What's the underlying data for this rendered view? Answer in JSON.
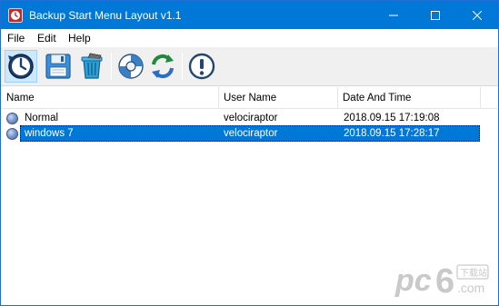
{
  "window": {
    "title": "Backup Start Menu Layout v1.1",
    "titlebar_color": "#0078d7"
  },
  "menubar": {
    "items": [
      {
        "label": "File"
      },
      {
        "label": "Edit"
      },
      {
        "label": "Help"
      }
    ]
  },
  "toolbar": {
    "buttons": [
      {
        "icon": "backup-clock-icon",
        "selected": true
      },
      {
        "icon": "save-floppy-icon"
      },
      {
        "icon": "recycle-bin-icon"
      },
      {
        "icon": "lifebuoy-icon"
      },
      {
        "icon": "refresh-icon"
      },
      {
        "icon": "exclamation-icon"
      }
    ]
  },
  "listview": {
    "columns": [
      "Name",
      "User Name",
      "Date And Time"
    ],
    "rows": [
      {
        "name": "Normal",
        "user": "velociraptor",
        "datetime": "2018.09.15 17:19:08",
        "selected": false
      },
      {
        "name": "windows 7",
        "user": "velociraptor",
        "datetime": "2018.09.15 17:28:17",
        "selected": true
      }
    ],
    "selection_color": "#0078d7"
  },
  "watermark": {
    "brand": "pc6",
    "tag": "下载站",
    "domain": ".com"
  }
}
